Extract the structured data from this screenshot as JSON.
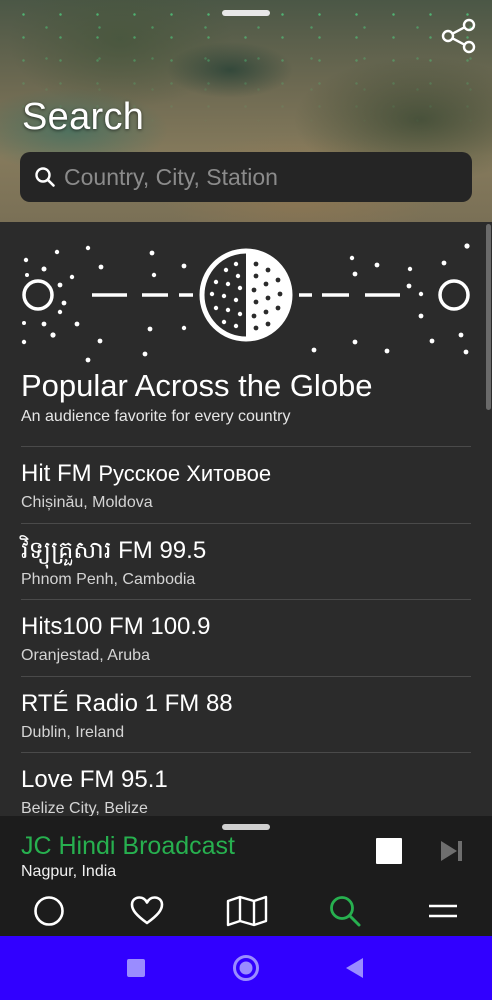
{
  "header": {
    "title": "Search",
    "search_placeholder": "Country, City, Station",
    "icons": {
      "search": "search-icon",
      "share": "share-icon"
    }
  },
  "section": {
    "title": "Popular Across the Globe",
    "subtitle": "An audience favorite for every country"
  },
  "stations": [
    {
      "name": "Hit FM",
      "name_alt": "Русское Хитовое",
      "location": "Chișinău, Moldova"
    },
    {
      "name": "វិទ្យុគ្រួសារ FM 99.5",
      "name_alt": "",
      "location": "Phnom Penh, Cambodia"
    },
    {
      "name": "Hits100 FM 100.9",
      "name_alt": "",
      "location": "Oranjestad, Aruba"
    },
    {
      "name": "RTÉ Radio 1 FM 88",
      "name_alt": "",
      "location": "Dublin, Ireland"
    },
    {
      "name": "Love FM 95.1",
      "name_alt": "",
      "location": "Belize City, Belize"
    }
  ],
  "now_playing": {
    "title": "JC Hindi Broadcast",
    "location": "Nagpur, India",
    "icons": {
      "stop": "stop-icon",
      "next": "skip-next-icon"
    }
  },
  "nav": {
    "items": [
      "explore-icon",
      "favorites-icon",
      "browse-map-icon",
      "search-icon",
      "menu-icon"
    ],
    "active": "search-icon"
  },
  "colors": {
    "accent": "#27b04f",
    "background": "#2b2b2b",
    "system_bar": "#3100ff"
  }
}
